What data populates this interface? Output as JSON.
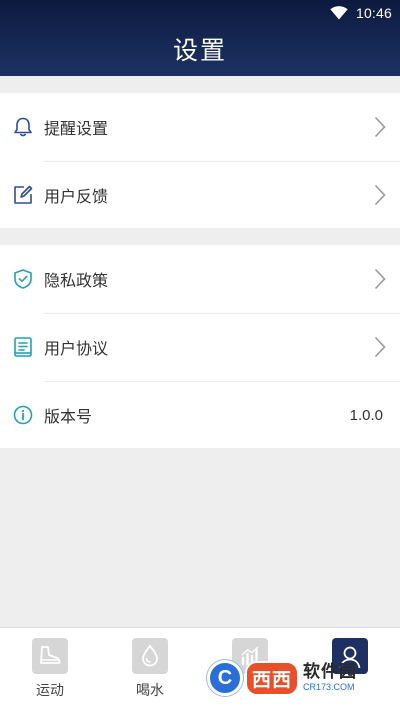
{
  "status_bar": {
    "time": "10:46",
    "wifi_icon": "wifi-icon"
  },
  "header": {
    "title": "设置"
  },
  "section_1": {
    "items": [
      {
        "icon": "bell-icon",
        "label": "提醒设置"
      },
      {
        "icon": "edit-icon",
        "label": "用户反馈"
      }
    ]
  },
  "section_2": {
    "items": [
      {
        "icon": "shield-check-icon",
        "label": "隐私政策"
      },
      {
        "icon": "document-icon",
        "label": "用户协议"
      },
      {
        "icon": "info-icon",
        "label": "版本号",
        "value": "1.0.0"
      }
    ]
  },
  "bottom_nav": {
    "items": [
      {
        "icon": "shoe-icon",
        "label": "运动"
      },
      {
        "icon": "water-drop-icon",
        "label": "喝水"
      },
      {
        "icon": "stats-chart-icon",
        "label": ""
      },
      {
        "icon": "user-icon",
        "label": "",
        "active": true
      }
    ]
  },
  "watermark": {
    "brand": "西西",
    "name": "软件园",
    "url": "CR173.COM"
  },
  "colors": {
    "header_dark": "#0d1a3f",
    "header_light": "#1d3264",
    "icon_blue": "#2b4e9e",
    "icon_teal": "#1fa2b8",
    "nav_active": "#1e2f63",
    "background": "#eeeeee"
  }
}
